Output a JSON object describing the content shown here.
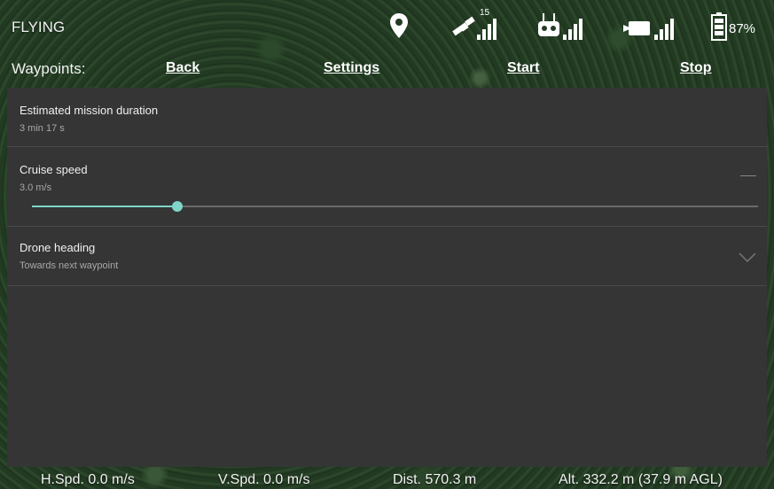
{
  "status": {
    "flight_mode": "FLYING",
    "gps_satellites": "15",
    "battery_percent": "87%"
  },
  "nav": {
    "label": "Waypoints:",
    "back": "Back",
    "settings": "Settings",
    "start": "Start",
    "stop": "Stop"
  },
  "settings": {
    "duration": {
      "title": "Estimated mission duration",
      "value": "3 min 17 s"
    },
    "cruise_speed": {
      "title": "Cruise speed",
      "value": "3.0 m/s",
      "slider_fraction": 0.2
    },
    "heading": {
      "title": "Drone heading",
      "value": "Towards next waypoint"
    }
  },
  "telemetry": {
    "h_speed": "H.Spd. 0.0 m/s",
    "v_speed": "V.Spd. 0.0 m/s",
    "distance": "Dist. 570.3 m",
    "altitude": "Alt. 332.2 m (37.9 m AGL)"
  },
  "colors": {
    "accent": "#7fd6c8",
    "panel": "#353535"
  },
  "icons": [
    "location-pin-icon",
    "satellite-icon",
    "remote-controller-icon",
    "camera-icon",
    "battery-icon"
  ]
}
